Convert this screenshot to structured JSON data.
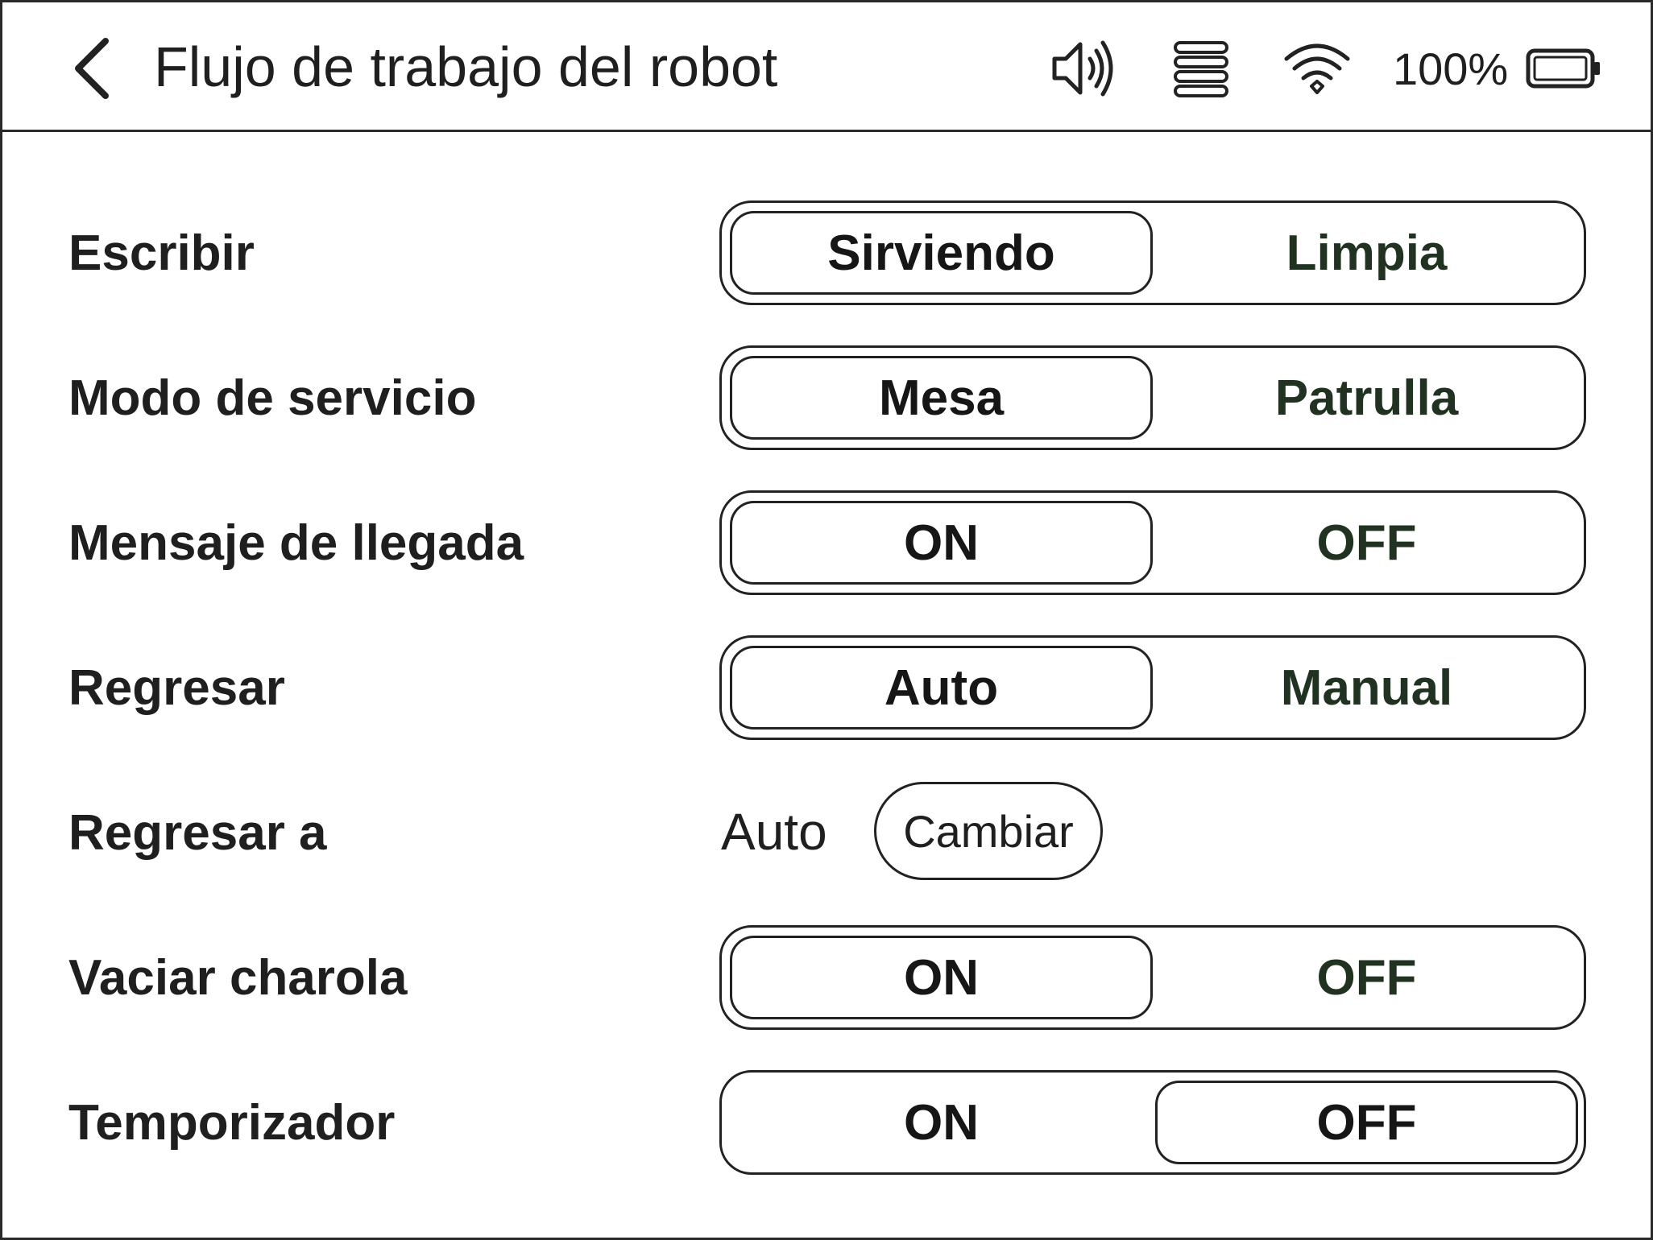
{
  "header": {
    "title": "Flujo de trabajo del robot",
    "battery_text": "100%",
    "icons": [
      "back-chevron-icon",
      "volume-icon",
      "list-icon",
      "wifi-icon",
      "battery-icon"
    ]
  },
  "rows": [
    {
      "label": "Escribir",
      "options": [
        "Sirviendo",
        "Limpia"
      ],
      "selected": "Sirviendo"
    },
    {
      "label": "Modo de servicio",
      "options": [
        "Mesa",
        "Patrulla"
      ],
      "selected": "Mesa"
    },
    {
      "label": "Mensaje de llegada",
      "options": [
        "ON",
        "OFF"
      ],
      "selected": "ON"
    },
    {
      "label": "Regresar",
      "options": [
        "Auto",
        "Manual"
      ],
      "selected": "Auto"
    },
    {
      "label": "Regresar a",
      "value": "Auto",
      "button": "Cambiar"
    },
    {
      "label": "Vaciar charola",
      "options": [
        "ON",
        "OFF"
      ],
      "selected": "ON"
    },
    {
      "label": "Temporizador",
      "options": [
        "ON",
        "OFF"
      ],
      "selected": "OFF"
    }
  ],
  "colors": {
    "border": "#222222",
    "text": "#1f1f1f",
    "unselected_text": "#1f3320",
    "background": "#ffffff"
  }
}
